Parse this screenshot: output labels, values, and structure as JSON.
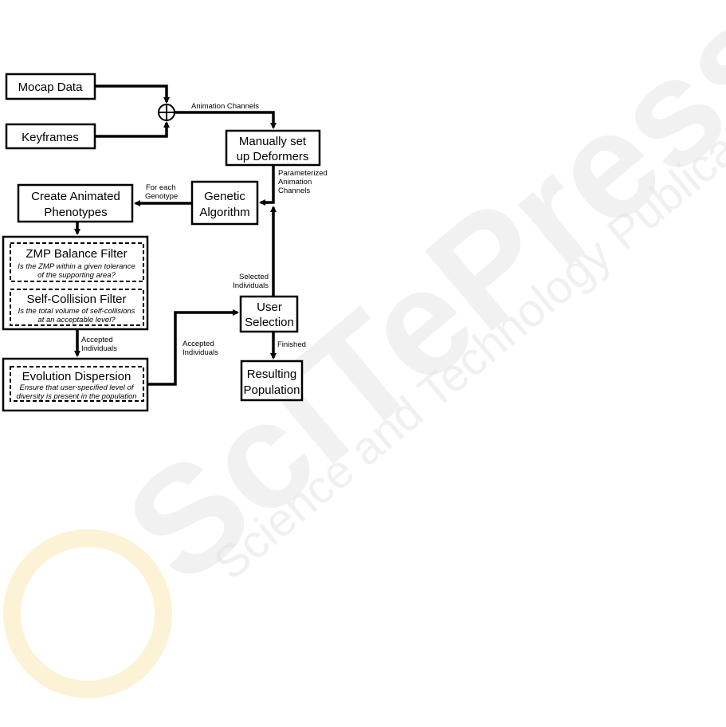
{
  "watermark": {
    "brand": "SciTePress",
    "tagline": "Science and Technology Publications",
    "logo_color": "#f2c94c"
  },
  "nodes": {
    "mocap": "Mocap Data",
    "keyframes": "Keyframes",
    "deformers": [
      "Manually set",
      "up Deformers"
    ],
    "genetic": [
      "Genetic",
      "Algorithm"
    ],
    "phenotypes": [
      "Create Animated",
      "Phenotypes"
    ],
    "zmp": {
      "title": "ZMP Balance Filter",
      "desc": [
        "Is the ZMP within a given tolerance",
        "of the supporting area?"
      ]
    },
    "collision": {
      "title": "Self-Collision Filter",
      "desc": [
        "Is the total volume of self-collisions",
        "at an acceptable level?"
      ]
    },
    "dispersion": {
      "title": "Evolution Dispersion",
      "desc": [
        "Ensure that user-specified level of",
        "diversity is present in the population"
      ]
    },
    "user": [
      "User",
      "Selection"
    ],
    "result": [
      "Resulting",
      "Population"
    ]
  },
  "edges": {
    "animation_channels": "Animation Channels",
    "parameterized": [
      "Parameterized",
      "Animation",
      "Channels"
    ],
    "for_each": [
      "For each",
      "Genotype"
    ],
    "accepted1": [
      "Accepted",
      "Individuals"
    ],
    "accepted2": [
      "Accepted",
      "Individuals"
    ],
    "selected": [
      "Selected",
      "Individuals"
    ],
    "finished": "Finished"
  }
}
